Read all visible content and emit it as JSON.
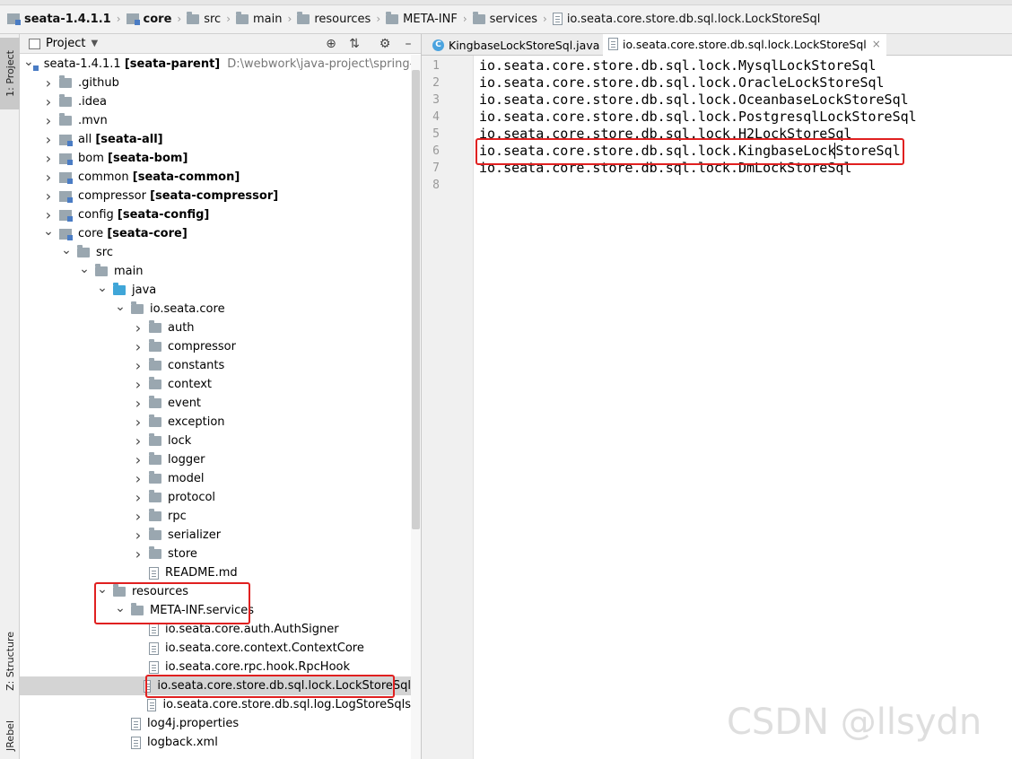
{
  "breadcrumb": {
    "items": [
      {
        "label": "seata-1.4.1.1",
        "icon": "module-icon",
        "bold": true
      },
      {
        "label": "core",
        "icon": "module-icon",
        "bold": true
      },
      {
        "label": "src",
        "icon": "folder-icon",
        "bold": false
      },
      {
        "label": "main",
        "icon": "folder-icon",
        "bold": false
      },
      {
        "label": "resources",
        "icon": "resources-folder-icon",
        "bold": false
      },
      {
        "label": "META-INF",
        "icon": "folder-icon",
        "bold": false
      },
      {
        "label": "services",
        "icon": "folder-icon",
        "bold": false
      },
      {
        "label": "io.seata.core.store.db.sql.lock.LockStoreSql",
        "icon": "file-icon",
        "bold": false
      }
    ]
  },
  "left_strip": {
    "project_tab": "1: Project",
    "structure_tab": "Z: Structure",
    "jrebel_tab": "JRebel"
  },
  "project_panel": {
    "title": "Project",
    "tree": [
      {
        "indent": 0,
        "arrow": "down",
        "icon": "module",
        "name": "seata-1.4.1.1",
        "bold_suffix": "[seata-parent]",
        "path": "D:\\webwork\\java-project\\spring-cloud-al"
      },
      {
        "indent": 1,
        "arrow": "right",
        "icon": "folder",
        "name": ".github"
      },
      {
        "indent": 1,
        "arrow": "right",
        "icon": "folder",
        "name": ".idea"
      },
      {
        "indent": 1,
        "arrow": "right",
        "icon": "folder",
        "name": ".mvn"
      },
      {
        "indent": 1,
        "arrow": "right",
        "icon": "module",
        "name": "all",
        "bold_suffix": "[seata-all]"
      },
      {
        "indent": 1,
        "arrow": "right",
        "icon": "module",
        "name": "bom",
        "bold_suffix": "[seata-bom]"
      },
      {
        "indent": 1,
        "arrow": "right",
        "icon": "module",
        "name": "common",
        "bold_suffix": "[seata-common]"
      },
      {
        "indent": 1,
        "arrow": "right",
        "icon": "module",
        "name": "compressor",
        "bold_suffix": "[seata-compressor]"
      },
      {
        "indent": 1,
        "arrow": "right",
        "icon": "module",
        "name": "config",
        "bold_suffix": "[seata-config]"
      },
      {
        "indent": 1,
        "arrow": "down",
        "icon": "module",
        "name": "core",
        "bold_suffix": "[seata-core]"
      },
      {
        "indent": 2,
        "arrow": "down",
        "icon": "folder",
        "name": "src"
      },
      {
        "indent": 3,
        "arrow": "down",
        "icon": "folder",
        "name": "main"
      },
      {
        "indent": 4,
        "arrow": "down",
        "icon": "folder-blue",
        "name": "java"
      },
      {
        "indent": 5,
        "arrow": "down",
        "icon": "package",
        "name": "io.seata.core"
      },
      {
        "indent": 6,
        "arrow": "right",
        "icon": "package",
        "name": "auth"
      },
      {
        "indent": 6,
        "arrow": "right",
        "icon": "package",
        "name": "compressor"
      },
      {
        "indent": 6,
        "arrow": "right",
        "icon": "package",
        "name": "constants"
      },
      {
        "indent": 6,
        "arrow": "right",
        "icon": "package",
        "name": "context"
      },
      {
        "indent": 6,
        "arrow": "right",
        "icon": "package",
        "name": "event"
      },
      {
        "indent": 6,
        "arrow": "right",
        "icon": "package",
        "name": "exception"
      },
      {
        "indent": 6,
        "arrow": "right",
        "icon": "package",
        "name": "lock"
      },
      {
        "indent": 6,
        "arrow": "right",
        "icon": "package",
        "name": "logger"
      },
      {
        "indent": 6,
        "arrow": "right",
        "icon": "package",
        "name": "model"
      },
      {
        "indent": 6,
        "arrow": "right",
        "icon": "package",
        "name": "protocol"
      },
      {
        "indent": 6,
        "arrow": "right",
        "icon": "package",
        "name": "rpc"
      },
      {
        "indent": 6,
        "arrow": "right",
        "icon": "package",
        "name": "serializer"
      },
      {
        "indent": 6,
        "arrow": "right",
        "icon": "package",
        "name": "store"
      },
      {
        "indent": 6,
        "arrow": "none",
        "icon": "md",
        "name": "README.md"
      },
      {
        "indent": 4,
        "arrow": "down",
        "icon": "resources",
        "name": "resources"
      },
      {
        "indent": 5,
        "arrow": "down",
        "icon": "folder",
        "name": "META-INF.services"
      },
      {
        "indent": 6,
        "arrow": "none",
        "icon": "file",
        "name": "io.seata.core.auth.AuthSigner"
      },
      {
        "indent": 6,
        "arrow": "none",
        "icon": "file",
        "name": "io.seata.core.context.ContextCore"
      },
      {
        "indent": 6,
        "arrow": "none",
        "icon": "file",
        "name": "io.seata.core.rpc.hook.RpcHook"
      },
      {
        "indent": 6,
        "arrow": "none",
        "icon": "file",
        "name": "io.seata.core.store.db.sql.lock.LockStoreSql",
        "selected": true
      },
      {
        "indent": 6,
        "arrow": "none",
        "icon": "file",
        "name": "io.seata.core.store.db.sql.log.LogStoreSqls"
      },
      {
        "indent": 5,
        "arrow": "none",
        "icon": "properties",
        "name": "log4j.properties"
      },
      {
        "indent": 5,
        "arrow": "none",
        "icon": "xml",
        "name": "logback.xml"
      }
    ]
  },
  "editor": {
    "tabs": [
      {
        "label": "KingbaseLockStoreSql.java",
        "icon": "class-icon",
        "active": false
      },
      {
        "label": "io.seata.core.store.db.sql.lock.LockStoreSql",
        "icon": "file-icon",
        "active": true
      }
    ],
    "lines": [
      "io.seata.core.store.db.sql.lock.MysqlLockStoreSql",
      "io.seata.core.store.db.sql.lock.OracleLockStoreSql",
      "io.seata.core.store.db.sql.lock.OceanbaseLockStoreSql",
      "io.seata.core.store.db.sql.lock.PostgresqlLockStoreSql",
      "io.seata.core.store.db.sql.lock.H2LockStoreSql",
      "io.seata.core.store.db.sql.lock.KingbaseLockStoreSql",
      "io.seata.core.store.db.sql.lock.DmLockStoreSql",
      ""
    ],
    "current_line": 6
  },
  "watermark": "CSDN @llsydn",
  "colors": {
    "highlight_box": "#e02020",
    "selection": "#d4d4d4",
    "current_line": "#e8eef8"
  }
}
